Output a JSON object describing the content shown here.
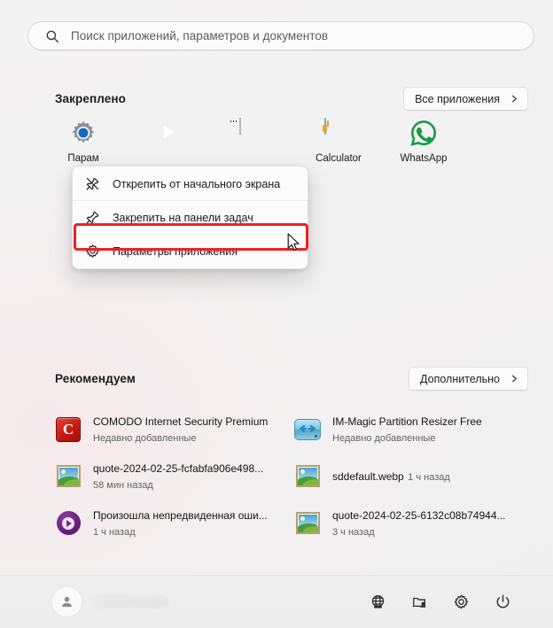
{
  "search": {
    "placeholder": "Поиск приложений, параметров и документов",
    "icon": "search-icon"
  },
  "pinned": {
    "title": "Закреплено",
    "all_apps_label": "Все приложения",
    "apps": [
      {
        "label": "Парам",
        "icon": "settings-gear-icon"
      },
      {
        "label": "",
        "icon": "media-player-icon"
      },
      {
        "label": "",
        "icon": "terminal-icon"
      },
      {
        "label": "Calculator",
        "icon": "calculator-icon"
      },
      {
        "label": "WhatsApp",
        "icon": "whatsapp-icon"
      }
    ]
  },
  "recommended": {
    "title": "Рекомендуем",
    "more_label": "Дополнительно",
    "items": [
      {
        "name": "COMODO Internet Security Premium",
        "meta": "Недавно добавленные",
        "icon": "comodo-icon"
      },
      {
        "name": "IM-Magic Partition Resizer Free",
        "meta": "Недавно добавленные",
        "icon": "imagic-icon"
      },
      {
        "name": "quote-2024-02-25-fcfabfa906e498...",
        "meta": "58 мин назад",
        "icon": "image-file-icon"
      },
      {
        "name": "sddefault.webp",
        "meta": "1 ч назад",
        "icon": "image-file-icon"
      },
      {
        "name": "Произошла непредвиденная оши...",
        "meta": "1 ч назад",
        "icon": "video-file-icon"
      },
      {
        "name": "quote-2024-02-25-6132c08b74944...",
        "meta": "3 ч назад",
        "icon": "image-file-icon"
      }
    ]
  },
  "context_menu": {
    "items": [
      {
        "label": "Открепить от начального экрана",
        "icon": "unpin-icon",
        "highlighted": false
      },
      {
        "label": "Закрепить на панели задач",
        "icon": "pin-icon",
        "highlighted": false
      },
      {
        "label": "Параметры приложения",
        "icon": "gear-icon",
        "highlighted": true
      }
    ]
  },
  "annotation": {
    "highlight_color": "#ef2121",
    "target": "Параметры приложения"
  },
  "bottom_bar": {
    "account_name": "",
    "icons": [
      {
        "name": "network-globe-icon"
      },
      {
        "name": "documents-folder-icon"
      },
      {
        "name": "settings-gear-icon"
      },
      {
        "name": "power-icon"
      }
    ]
  }
}
